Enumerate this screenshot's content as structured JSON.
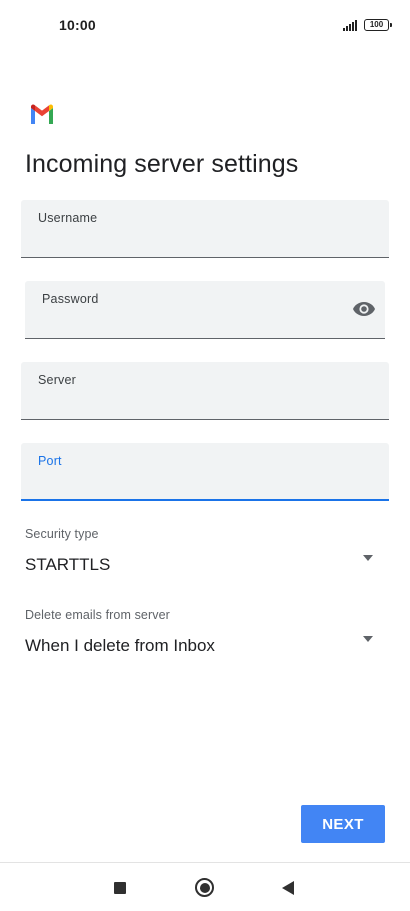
{
  "status_bar": {
    "time": "10:00",
    "battery": "100",
    "signal_icon": "signal-icon"
  },
  "app": {
    "logo_icon": "gmail-logo"
  },
  "page_title": "Incoming server settings",
  "fields": {
    "username": {
      "label": "Username",
      "value": ""
    },
    "password": {
      "label": "Password",
      "value": "",
      "toggle_icon": "eye-icon"
    },
    "server": {
      "label": "Server",
      "value": ""
    },
    "port": {
      "label": "Port",
      "value": "",
      "focused": true
    }
  },
  "security_type": {
    "caption": "Security type",
    "value": "STARTTLS"
  },
  "delete_emails": {
    "caption": "Delete emails from server",
    "value": "When I delete from Inbox"
  },
  "actions": {
    "next_label": "NEXT"
  },
  "colors": {
    "accent": "#1a73e8",
    "button": "#4285f4",
    "field_bg": "#f1f3f4"
  }
}
